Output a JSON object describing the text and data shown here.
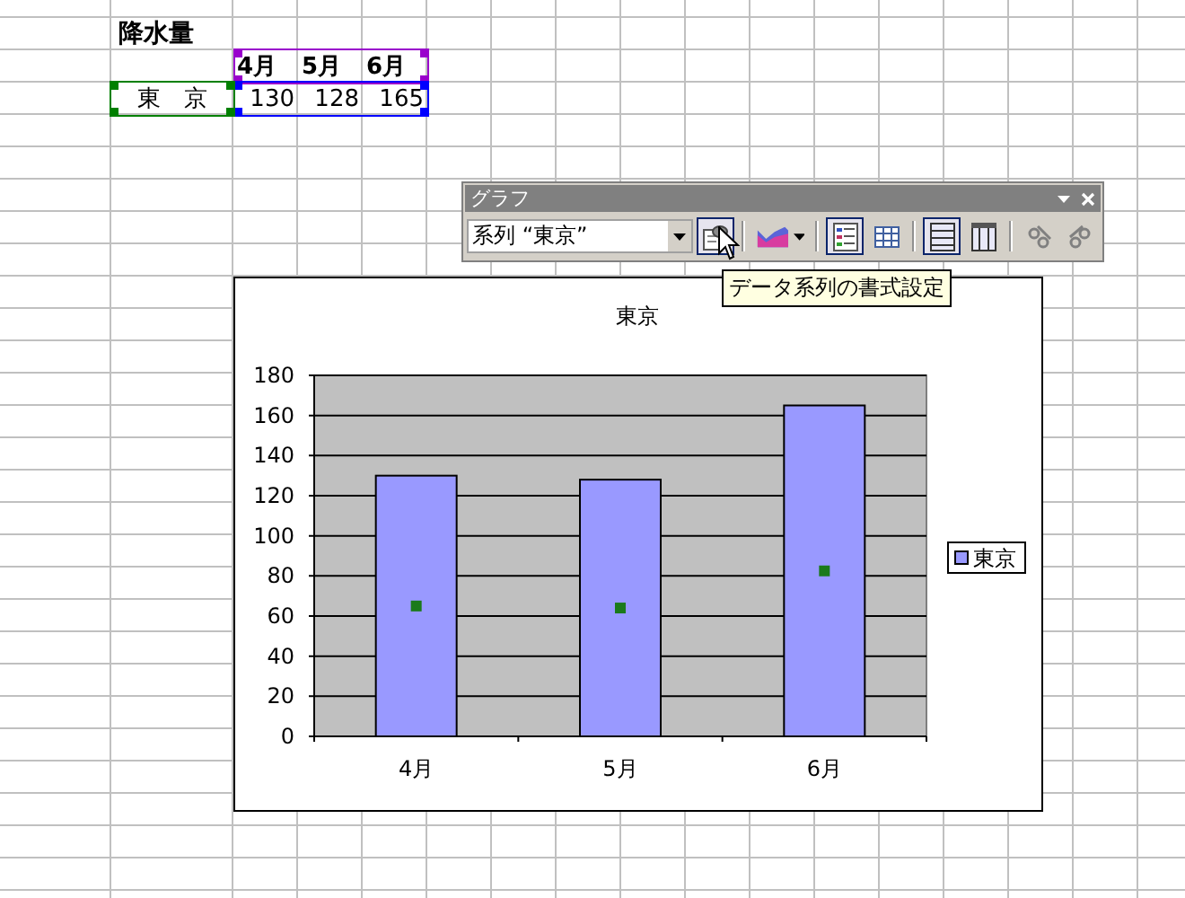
{
  "sheet": {
    "title": "降水量",
    "header": [
      "4月",
      "5月",
      "6月"
    ],
    "rows": [
      {
        "label": "東　京",
        "values": [
          "130",
          "128",
          "165"
        ]
      }
    ]
  },
  "chart_toolbar": {
    "title": "グラフ",
    "object_dropdown": {
      "value": "系列 “東京”"
    },
    "buttons": [
      {
        "kind": "format",
        "selected": true
      },
      {
        "kind": "chart-type",
        "selected": false
      },
      {
        "kind": "legend",
        "selected": true
      },
      {
        "kind": "data-table",
        "selected": false
      },
      {
        "kind": "by-row",
        "selected": true
      },
      {
        "kind": "by-column",
        "selected": false
      },
      {
        "kind": "angle-down",
        "selected": false
      },
      {
        "kind": "angle-up",
        "selected": false
      }
    ],
    "tooltip": "データ系列の書式設定"
  },
  "chart": {
    "series_selected": true,
    "chart_data": {
      "type": "bar",
      "title": "東京",
      "categories": [
        "4月",
        "5月",
        "6月"
      ],
      "series": [
        {
          "name": "東京",
          "color": "#9999ff",
          "values": [
            130,
            128,
            165
          ]
        }
      ],
      "grid": true,
      "ylim": [
        0,
        180
      ],
      "yticks": [
        0,
        20,
        40,
        60,
        80,
        100,
        120,
        140,
        160,
        180
      ]
    }
  }
}
